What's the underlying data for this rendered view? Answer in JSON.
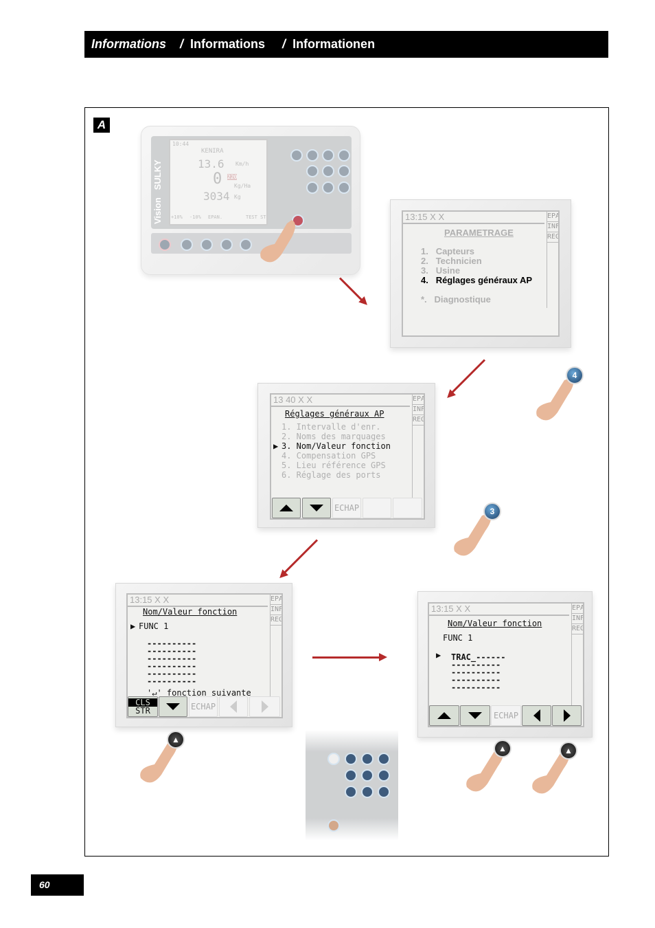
{
  "header": {
    "title_fr": "Informations",
    "sep1": "/",
    "title_en": "Informations",
    "sep2": "/",
    "title_de": "Informationen"
  },
  "figure_label": "A",
  "device": {
    "brand": "SULKY",
    "model": "Vision",
    "screen": {
      "time": "10:44",
      "product": "KENIRA",
      "speed": "13.6",
      "speed_unit": "Km/h",
      "rate": "0",
      "rate_unit": "Kg/Ha",
      "target": "220",
      "weight": "3034",
      "weight_unit": "Kg",
      "softkeys": [
        "+10%",
        "-10%",
        "EPAN.",
        "",
        "TEST STOP"
      ]
    }
  },
  "screen1": {
    "time": "13:15",
    "title": "PARAMETRAGE",
    "items": [
      {
        "num": "1.",
        "label": "Capteurs"
      },
      {
        "num": "2.",
        "label": "Technicien"
      },
      {
        "num": "3.",
        "label": "Usine"
      },
      {
        "num": "4.",
        "label": "Réglages généraux AP"
      },
      {
        "num": "*.",
        "label": "Diagnostique"
      }
    ],
    "tabs": [
      "EPAN",
      "INFO",
      "REG"
    ]
  },
  "screen2": {
    "time": "13 40",
    "title": "Réglages généraux AP",
    "items": [
      "1. Intervalle d'enr.",
      "2. Noms des marquages",
      "3. Nom/Valeur fonction",
      "4. Compensation GPS",
      "5. Lieu référence GPS",
      "6. Réglage des ports"
    ],
    "selected_index": 2,
    "softkeys": [
      "ECHAP"
    ],
    "tabs": [
      "EPAN",
      "INFO",
      "REG"
    ]
  },
  "screen3": {
    "time": "13:15",
    "title": "Nom/Valeur fonction",
    "func": "FUNC 1",
    "lines": [
      "----------",
      "----------",
      "----------",
      "----------",
      "----------",
      "----------"
    ],
    "hint": "'↵' fonction suivante",
    "softkeys": {
      "cls": "CLS",
      "str": "STR",
      "esc": "ECHAP"
    },
    "tabs": [
      "EPAN",
      "INFO",
      "REG"
    ]
  },
  "screen4": {
    "time": "13:15",
    "title": "Nom/Valeur fonction",
    "func": "FUNC 1",
    "first_line": "TRAC_------",
    "lines": [
      "----------",
      "----------",
      "----------",
      "----------"
    ],
    "softkeys": {
      "esc": "ECHAP"
    },
    "tabs": [
      "EPAN",
      "INFO",
      "REG"
    ]
  },
  "press_buttons": [
    "4",
    "3"
  ],
  "colors": {
    "arrow": "#b52a2a",
    "header_bg": "#000000"
  },
  "page_number": "60"
}
